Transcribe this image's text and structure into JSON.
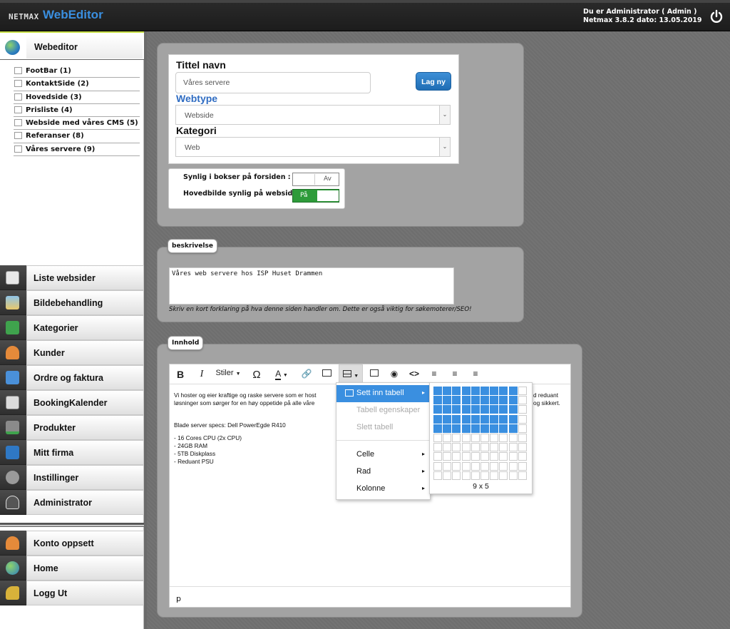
{
  "app": {
    "brand_small": "NETMAX",
    "brand_big": "WebEditor",
    "user_line1": "Du er Administrator ( Admin )",
    "user_line2": "Netmax 3.8.2 dato: 13.05.2019"
  },
  "sidebar": {
    "header": "Webeditor",
    "tree": [
      "FootBar (1)",
      "KontaktSide (2)",
      "Hovedside (3)",
      "Prisliste (4)",
      "Webside med våres CMS (5)",
      "Referanser (8)",
      "Våres servere (9)"
    ],
    "nav": [
      "Liste websider",
      "Bildebehandling",
      "Kategorier",
      "Kunder",
      "Ordre og faktura",
      "BookingKalender",
      "Produkter",
      "Mitt firma",
      "Instillinger",
      "Administrator"
    ],
    "nav_bottom": [
      "Konto oppsett",
      "Home",
      "Logg Ut"
    ]
  },
  "form": {
    "title_label": "Tittel navn",
    "title_value": "Våres servere",
    "create_button": "Lag ny",
    "webtype_label": "Webtype",
    "webtype_value": "Webside",
    "kategori_label": "Kategori",
    "kategori_value": "Web",
    "synlig_label": "Synlig i bokser på forsiden :",
    "synlig_value": "Av",
    "hovedbilde_label": "Hovedbilde synlig på websiden :",
    "hovedbilde_value": "På"
  },
  "beskrivelse": {
    "tag": "beskrivelse",
    "text": "Våres web servere hos ISP Huset Drammen",
    "help": "Skriv en kort forklaring på hva denne siden handler om. Dette er også viktig for søkemoterer/SEO!"
  },
  "innhold": {
    "tag": "Innhold",
    "toolbar": {
      "bold": "B",
      "italic": "I",
      "styles": "Stiler",
      "omega": "Ω",
      "fontcolor": "A"
    },
    "content_lines": [
      "Vi hoster og eier kraftige og raske servere som er host",
      "løsninger som sørger for en høy oppetide på alle våre",
      "Blade server specs:  Dell PowerEgde R410",
      "- 16 Cores CPU (2x CPU)",
      "- 24GB RAM",
      "- 5TB Diskplass",
      "- Reduant PSU"
    ],
    "content_right": [
      "d reduant",
      "og sikkert."
    ],
    "status_path": "p",
    "table_menu": {
      "items": [
        "Sett inn tabell",
        "Tabell egenskaper",
        "Slett tabell",
        "Celle",
        "Rad",
        "Kolonne"
      ],
      "grid_label": "9 x 5",
      "grid_cols_selected": 9,
      "grid_rows_selected": 5
    }
  },
  "colors": {
    "accent": "#3a8fe0",
    "green_toggle": "#2e9b3a",
    "panel": "#a3a3a3"
  }
}
